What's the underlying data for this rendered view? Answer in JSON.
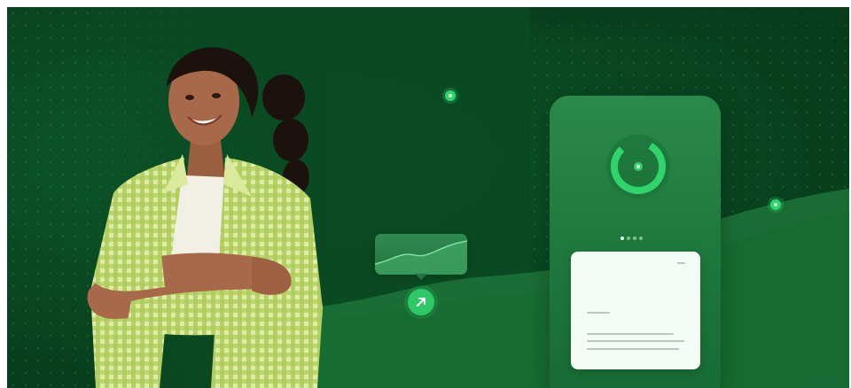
{
  "hero": {
    "scene": "hero-banner",
    "colors": {
      "background": "#0a4a22",
      "accent": "#2fd46b",
      "phone": "#1f7a3e",
      "card": "#f3fbf5",
      "shirt": "#c9dd7a"
    },
    "icons": {
      "arrow": "arrow-up-right-icon",
      "ring": "progress-ring-icon"
    }
  }
}
